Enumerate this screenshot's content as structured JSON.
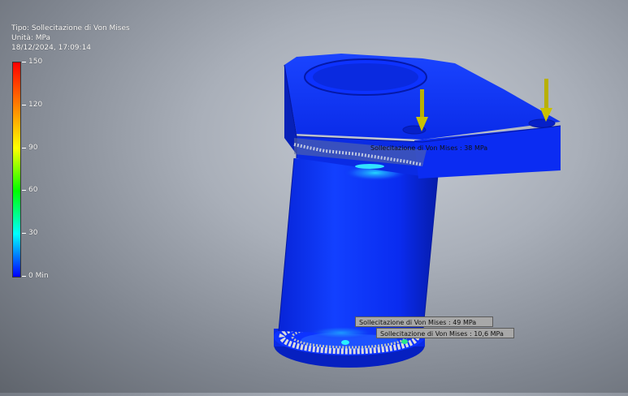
{
  "result_header": {
    "type_line": "Tipo: Sollecitazione di Von Mises",
    "unit_line": "Unità: MPa",
    "timestamp": "18/12/2024, 17:09:14"
  },
  "legend": {
    "ticks": [
      {
        "label": "150",
        "value": 150
      },
      {
        "label": "120",
        "value": 120
      },
      {
        "label": "90",
        "value": 90
      },
      {
        "label": "60",
        "value": 60
      },
      {
        "label": "30",
        "value": 30
      },
      {
        "label": "0 Min",
        "value": 0
      }
    ],
    "max": 150,
    "min": 0,
    "colors": [
      "#ff0000",
      "#ff7f00",
      "#ffff00",
      "#00ff00",
      "#00ffff",
      "#0000ff"
    ]
  },
  "probes": [
    {
      "label": "Sollecitazione di Von Mises : 38 MPa"
    },
    {
      "label": "Sollecitazione di Von Mises : 49 MPa"
    },
    {
      "label": "Sollecitazione di Von Mises : 10,6 MPa"
    }
  ],
  "colors": {
    "model_blue": "#0b2cf0",
    "model_dark": "#071a9a",
    "load_arrow": "#b8b000"
  }
}
